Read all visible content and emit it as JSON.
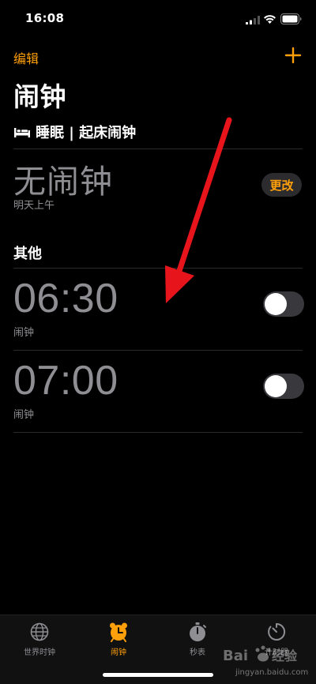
{
  "status_bar": {
    "time": "16:08"
  },
  "nav": {
    "edit_label": "编辑"
  },
  "page": {
    "title": "闹钟"
  },
  "sleep": {
    "header": "睡眠 | 起床闹钟",
    "no_alarm": "无闹钟",
    "subtitle": "明天上午",
    "change_label": "更改"
  },
  "other": {
    "section_label": "其他",
    "alarms": [
      {
        "time": "06:30",
        "label": "闹钟",
        "enabled": false
      },
      {
        "time": "07:00",
        "label": "闹钟",
        "enabled": false
      }
    ]
  },
  "tab_bar": {
    "items": [
      {
        "label": "世界时钟",
        "icon": "globe-icon",
        "active": false
      },
      {
        "label": "闹钟",
        "icon": "alarm-clock-icon",
        "active": true
      },
      {
        "label": "秒表",
        "icon": "stopwatch-icon",
        "active": false
      },
      {
        "label": "计时器",
        "icon": "timer-icon",
        "active": false
      }
    ]
  },
  "watermark": {
    "text": "jingyan.baidu.com"
  },
  "colors": {
    "accent": "#ff9f0a",
    "annotation": "#e8141c",
    "secondary_text": "#8e8e93"
  }
}
